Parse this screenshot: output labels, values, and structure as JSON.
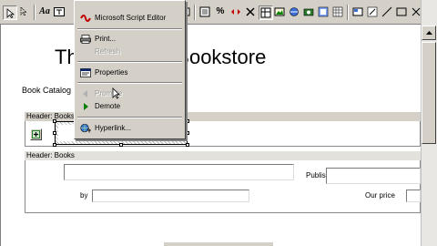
{
  "document": {
    "title": "The Brothers Bookstore",
    "catalog_text": "Book Catalog",
    "header_region_label": "Header: Books",
    "header_region_label_2": "Header: Books",
    "published_by_label": "Published by:",
    "by_label": "by",
    "our_price_label": "Our price"
  },
  "context_menu": {
    "items": [
      {
        "label": "Microsoft Script Editor",
        "icon": "script-editor-icon",
        "enabled": true
      },
      {
        "label": "Print...",
        "icon": "print-icon",
        "enabled": true
      },
      {
        "label": "Refresh",
        "icon": "",
        "enabled": false
      },
      {
        "label": "Properties",
        "icon": "properties-icon",
        "enabled": true
      },
      {
        "label": "Promote",
        "icon": "promote-arrow-icon",
        "enabled": false
      },
      {
        "label": "Demote",
        "icon": "demote-arrow-icon",
        "enabled": true
      },
      {
        "label": "Hyperlink...",
        "icon": "hyperlink-globe-icon",
        "enabled": true
      }
    ]
  },
  "colors": {
    "chrome": "#d4d0c8",
    "page": "#ffffff",
    "disabled_text": "#9c9c9c",
    "demote_arrow": "#008000",
    "script_editor_red": "#c00000"
  },
  "toolbar": {
    "font_button": "Aa",
    "percent_button": "%"
  }
}
